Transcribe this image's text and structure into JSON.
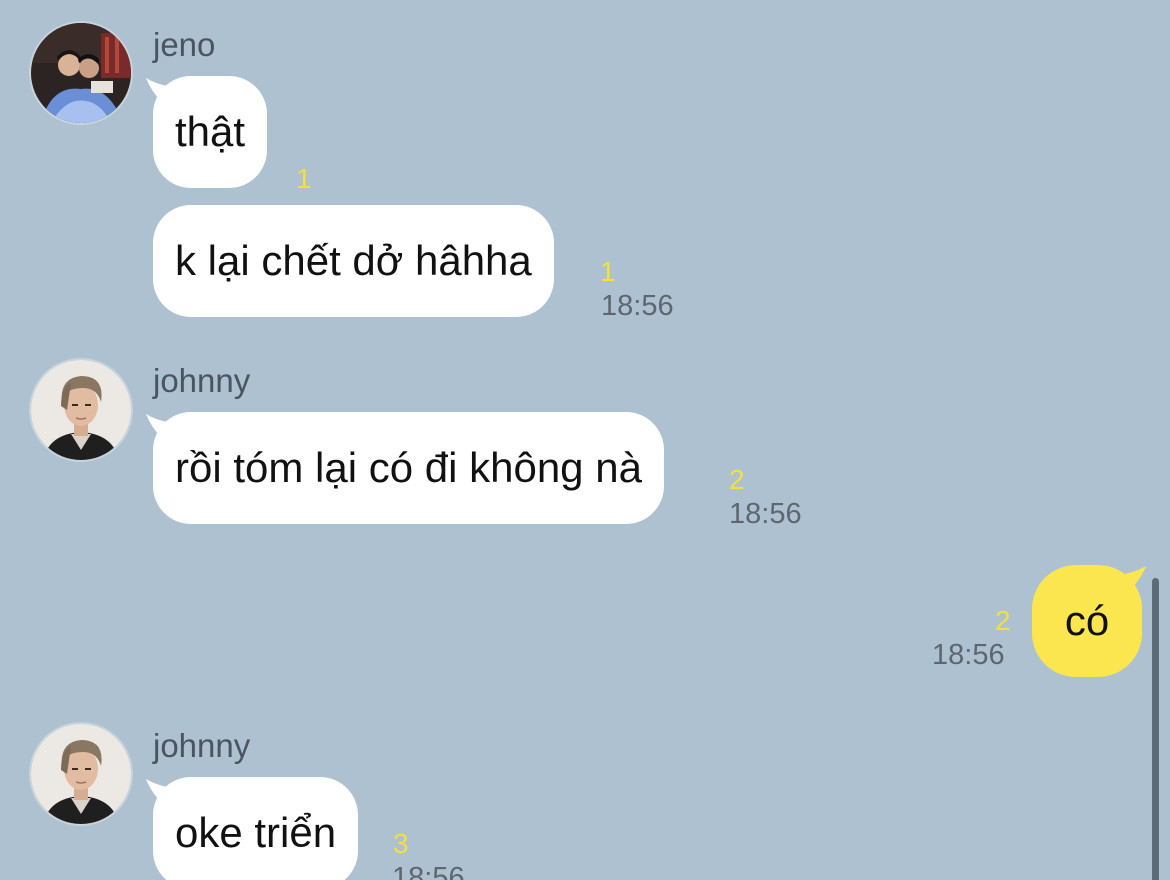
{
  "messages": [
    {
      "sender": "jeno",
      "avatar_icon": "avatar-photo-jeno",
      "bubbles": [
        {
          "text": "thật",
          "unread": "1",
          "time": ""
        },
        {
          "text": "k lại chết dở hâhha",
          "unread": "1",
          "time": "18:56"
        }
      ]
    },
    {
      "sender": "johnny",
      "avatar_icon": "avatar-photo-johnny",
      "bubbles": [
        {
          "text": "rồi tóm lại có đi không nà",
          "unread": "2",
          "time": "18:56"
        }
      ]
    },
    {
      "sender": "",
      "mine": true,
      "bubbles": [
        {
          "text": "có",
          "unread": "2",
          "time": "18:56"
        }
      ]
    },
    {
      "sender": "johnny",
      "avatar_icon": "avatar-photo-johnny",
      "bubbles": [
        {
          "text": "oke triển",
          "unread": "3",
          "time": "18:56"
        }
      ]
    }
  ],
  "colors": {
    "background": "#adc1d1",
    "incoming_bubble": "#ffffff",
    "outgoing_bubble": "#fbe64f",
    "unread_count": "#f4df3c",
    "timestamp": "#5e6770"
  }
}
